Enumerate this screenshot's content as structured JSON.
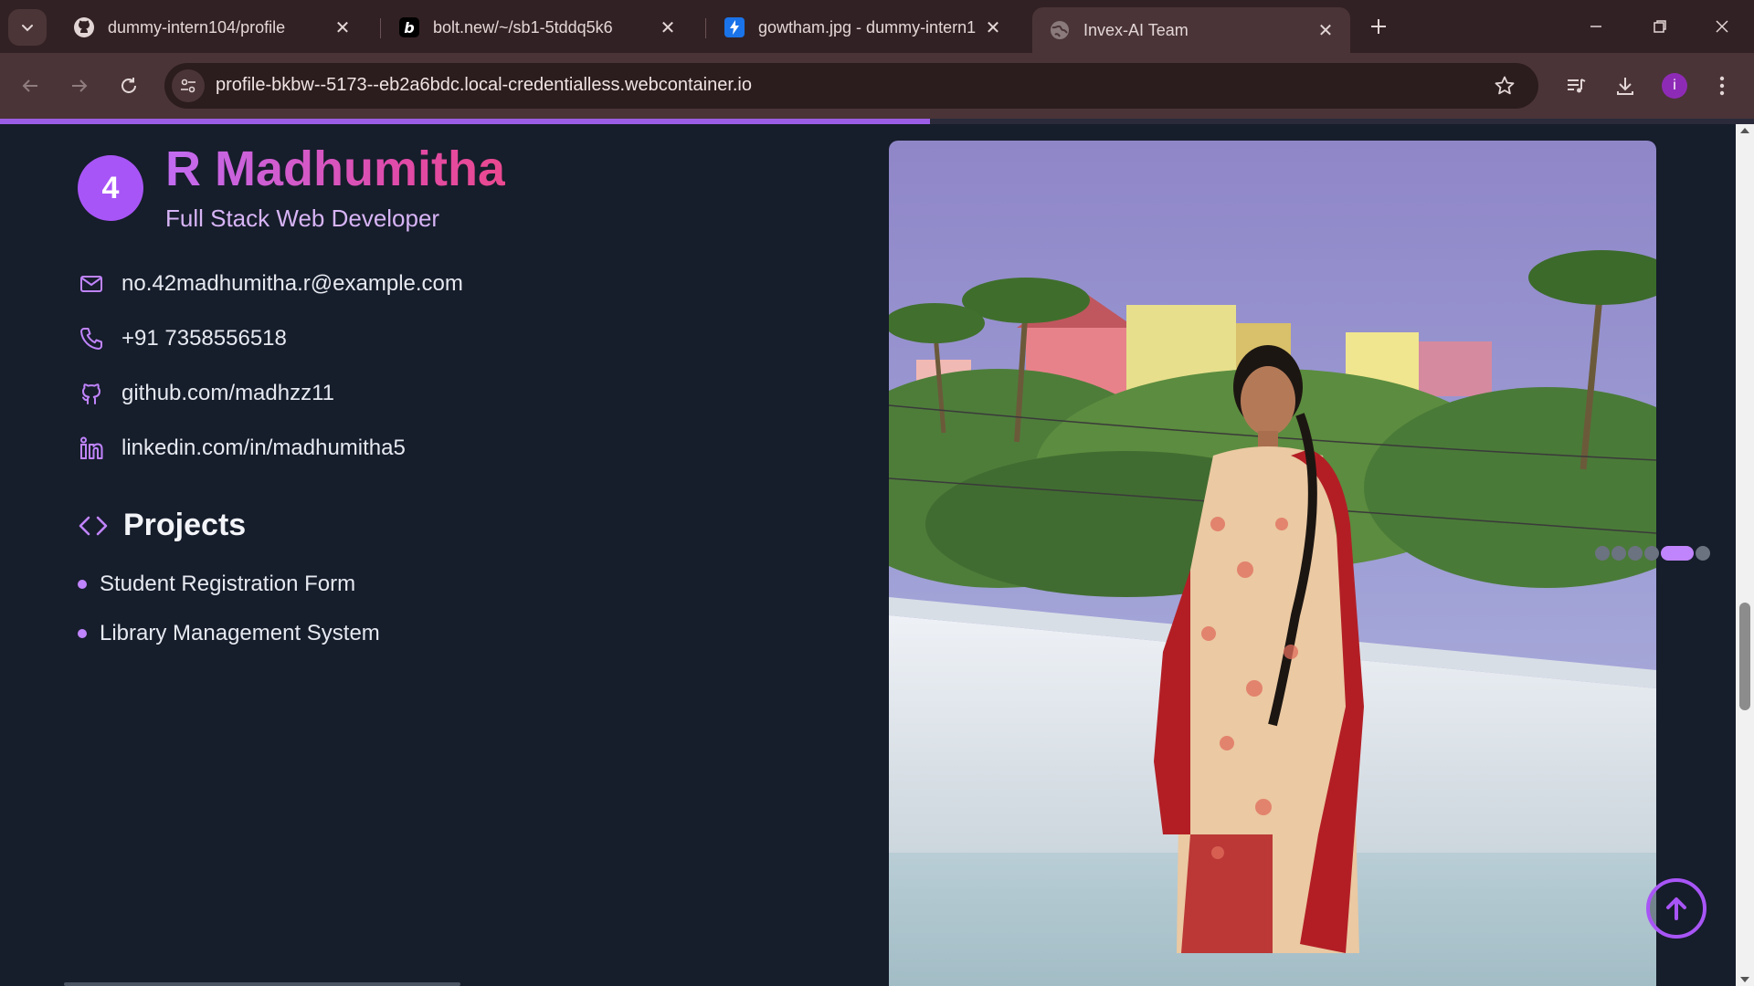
{
  "browser": {
    "tabs": [
      {
        "title": "dummy-intern104/profile",
        "favicon": "github-icon"
      },
      {
        "title": "bolt.new/~/sb1-5tddq5k6",
        "favicon": "bolt-icon"
      },
      {
        "title": "gowtham.jpg - dummy-intern1",
        "favicon": "lightning-icon"
      },
      {
        "title": "Invex-AI Team",
        "favicon": "globe-icon"
      }
    ],
    "url": "profile-bkbw--5173--eb2a6bdc.local-credentialless.webcontainer.io",
    "profile_initial": "i",
    "load_progress": 0.53
  },
  "profile": {
    "rank": "4",
    "name": "R Madhumitha",
    "role": "Full Stack Web Developer",
    "contacts": [
      {
        "icon": "mail-icon",
        "text": "no.42madhumitha.r@example.com"
      },
      {
        "icon": "phone-icon",
        "text": "+91 7358556518"
      },
      {
        "icon": "github-icon",
        "text": "github.com/madhzz11"
      },
      {
        "icon": "linkedin-icon",
        "text": "linkedin.com/in/madhumitha5"
      }
    ],
    "projects_heading": "Projects",
    "projects": [
      "Student Registration Form",
      "Library Management System"
    ]
  },
  "carousel": {
    "count": 6,
    "active_index": 4
  },
  "colors": {
    "accent": "#a855f7",
    "page_bg": "#161d2b",
    "name_gradient_start": "#c26cf2",
    "name_gradient_end": "#ea4990"
  }
}
